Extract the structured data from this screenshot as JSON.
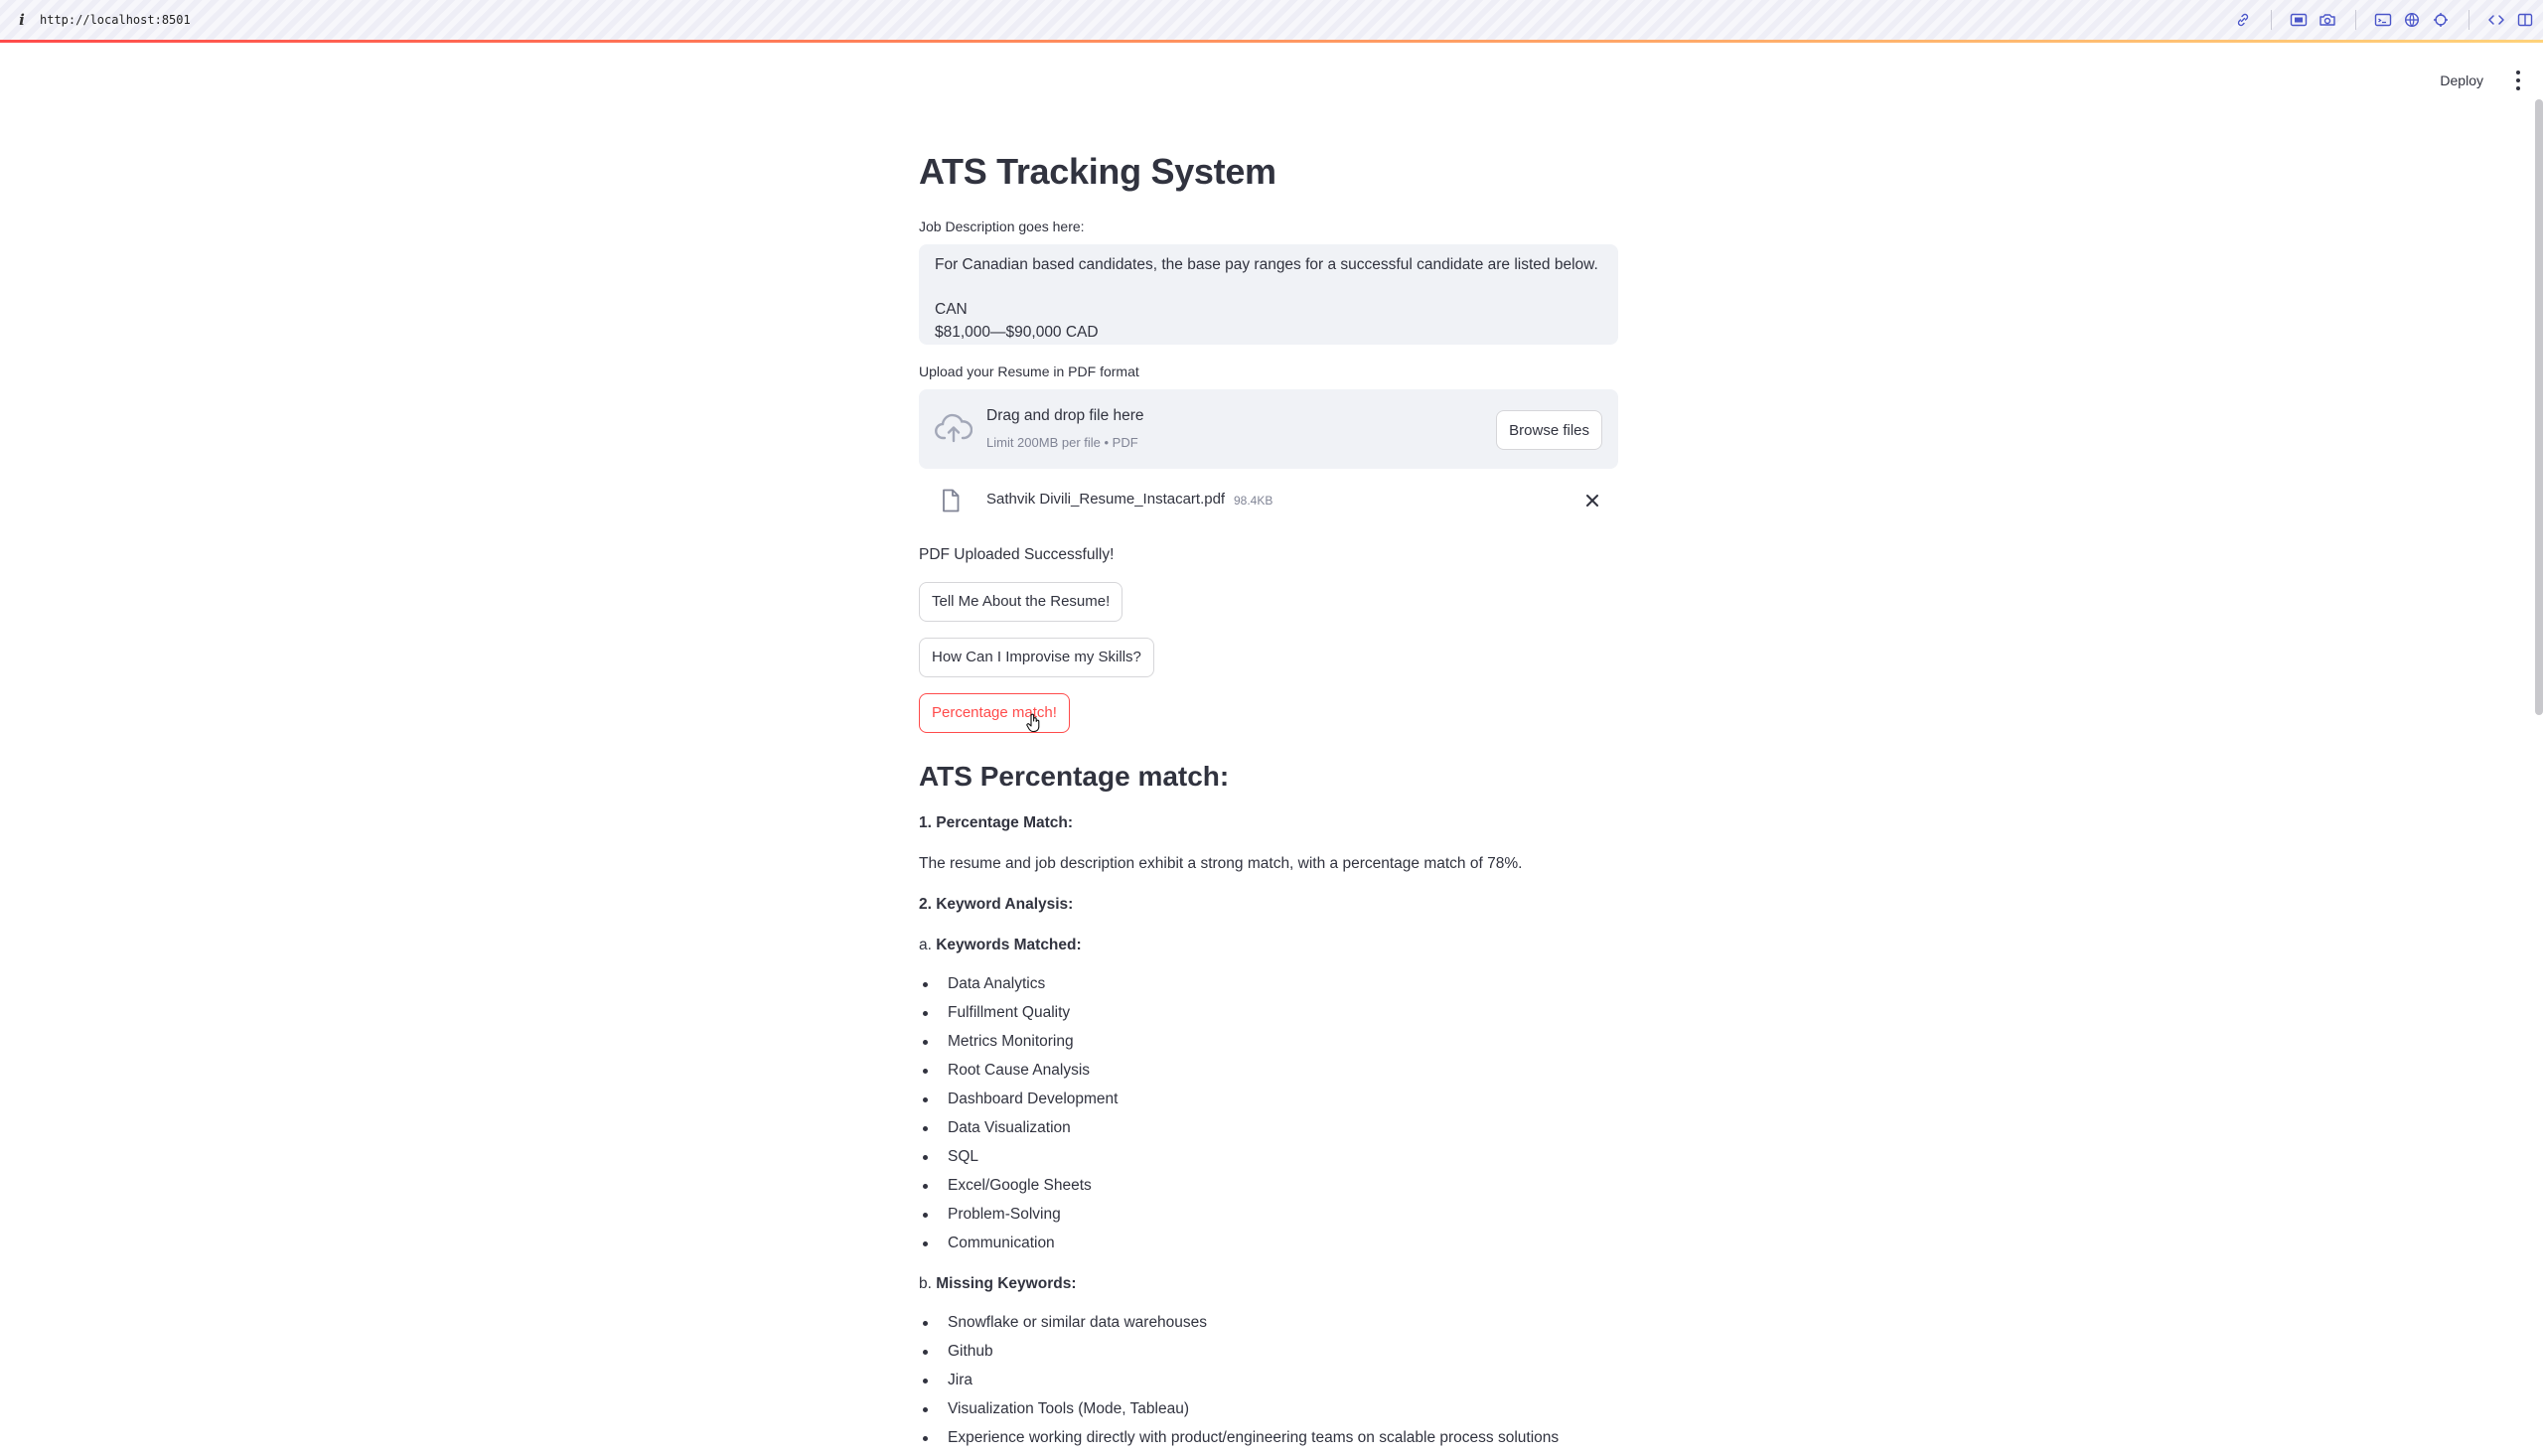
{
  "browser": {
    "url": "http://localhost:8501"
  },
  "header": {
    "deploy_label": "Deploy"
  },
  "app": {
    "title": "ATS Tracking System",
    "jd_label": "Job Description goes here:",
    "jd_text": "For Canadian based candidates, the base pay ranges for a successful candidate are listed below.\n\nCAN\n$81,000—$90,000 CAD",
    "upload_label": "Upload your Resume in PDF format",
    "dropzone_title": "Drag and drop file here",
    "dropzone_limit": "Limit 200MB per file • PDF",
    "browse_label": "Browse files",
    "file_name": "Sathvik Divili_Resume_Instacart.pdf",
    "file_size": "98.4KB",
    "status": "PDF Uploaded Successfully!",
    "buttons": {
      "about": "Tell Me About the Resume!",
      "improve": "How Can I Improvise my Skills?",
      "match": "Percentage match!"
    }
  },
  "result": {
    "heading": "ATS Percentage match:",
    "section1_title": "1. Percentage Match:",
    "section1_text": "The resume and job description exhibit a strong match, with a percentage match of 78%.",
    "section2_title": "2. Keyword Analysis:",
    "matched_prefix": "a. ",
    "matched_title": "Keywords Matched:",
    "matched": [
      "Data Analytics",
      "Fulfillment Quality",
      "Metrics Monitoring",
      "Root Cause Analysis",
      "Dashboard Development",
      "Data Visualization",
      "SQL",
      "Excel/Google Sheets",
      "Problem-Solving",
      "Communication"
    ],
    "missing_prefix": "b. ",
    "missing_title": "Missing Keywords:",
    "missing": [
      "Snowflake or similar data warehouses",
      "Github",
      "Jira",
      "Visualization Tools (Mode, Tableau)",
      "Experience working directly with product/engineering teams on scalable process solutions"
    ]
  }
}
